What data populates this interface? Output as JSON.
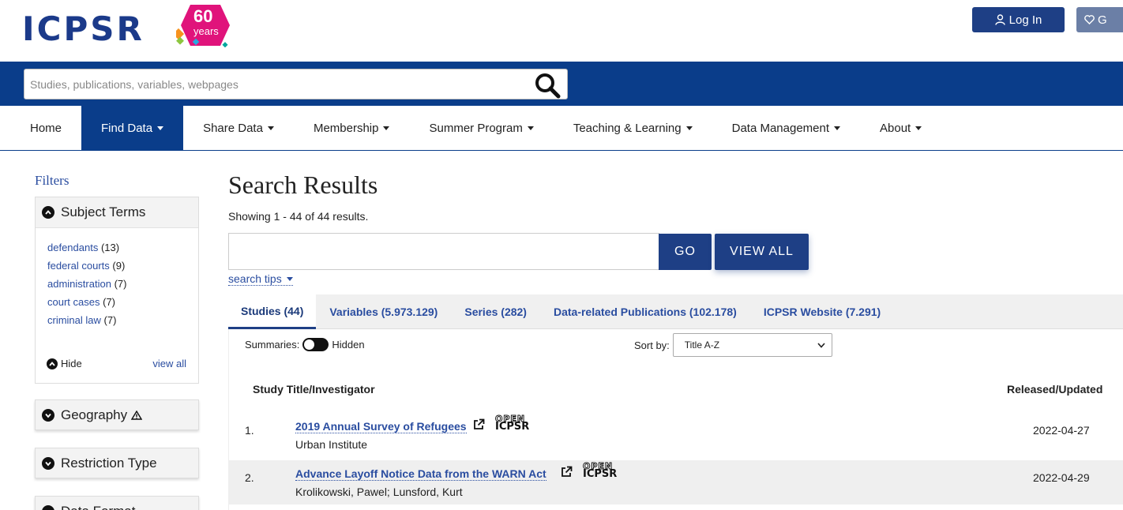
{
  "header": {
    "logo_text": "ICPSR",
    "logo_badge_number": "60",
    "logo_badge_label": "years",
    "login_label": "Log In",
    "give_label": "G"
  },
  "search": {
    "placeholder": "Studies, publications, variables, webpages"
  },
  "nav": {
    "items": [
      {
        "label": "Home"
      },
      {
        "label": "Find Data"
      },
      {
        "label": "Share Data"
      },
      {
        "label": "Membership"
      },
      {
        "label": "Summer Program"
      },
      {
        "label": "Teaching & Learning"
      },
      {
        "label": "Data Management"
      },
      {
        "label": "About"
      }
    ]
  },
  "sidebar": {
    "title": "Filters",
    "subject_terms": {
      "heading": "Subject Terms",
      "items": [
        {
          "label": "defendants",
          "count": "(13)"
        },
        {
          "label": "federal courts",
          "count": "(9)"
        },
        {
          "label": "administration",
          "count": "(7)"
        },
        {
          "label": "court cases",
          "count": "(7)"
        },
        {
          "label": "criminal law",
          "count": "(7)"
        }
      ],
      "hide_label": "Hide",
      "view_all_label": "view all"
    },
    "geography": {
      "heading": "Geography"
    },
    "restriction": {
      "heading": "Restriction Type"
    },
    "data_format": {
      "heading": "Data Format"
    }
  },
  "main": {
    "title": "Search Results",
    "showing": "Showing 1 - 44 of 44 results.",
    "search_value": "",
    "go_label": "GO",
    "view_all_label": "VIEW ALL",
    "search_tips_label": "search tips",
    "tabs": [
      {
        "label": "Studies (44)"
      },
      {
        "label": "Variables (5.973.129)"
      },
      {
        "label": "Series (282)"
      },
      {
        "label": "Data-related Publications (102.178)"
      },
      {
        "label": "ICPSR Website (7.291)"
      }
    ],
    "summaries_label": "Summaries:",
    "summaries_state": "Hidden",
    "sort_by_label": "Sort by:",
    "sort_value": "Title A-Z",
    "col_title": "Study Title/Investigator",
    "col_released": "Released/Updated",
    "open_badge_top": "OPEN",
    "open_badge_bottom": "ICPSR",
    "results": [
      {
        "num": "1.",
        "title": "2019 Annual Survey of Refugees",
        "investigator": "Urban Institute",
        "date": "2022-04-27"
      },
      {
        "num": "2.",
        "title": "Advance Layoff Notice Data from the WARN Act",
        "investigator": "Krolikowski, Pawel; Lunsford, Kurt",
        "date": "2022-04-29"
      }
    ]
  },
  "colors": {
    "brand_blue": "#0a3d8a",
    "button_blue": "#1e3f85",
    "link_blue": "#2a4da0",
    "logo_pink": "#e0137b"
  }
}
